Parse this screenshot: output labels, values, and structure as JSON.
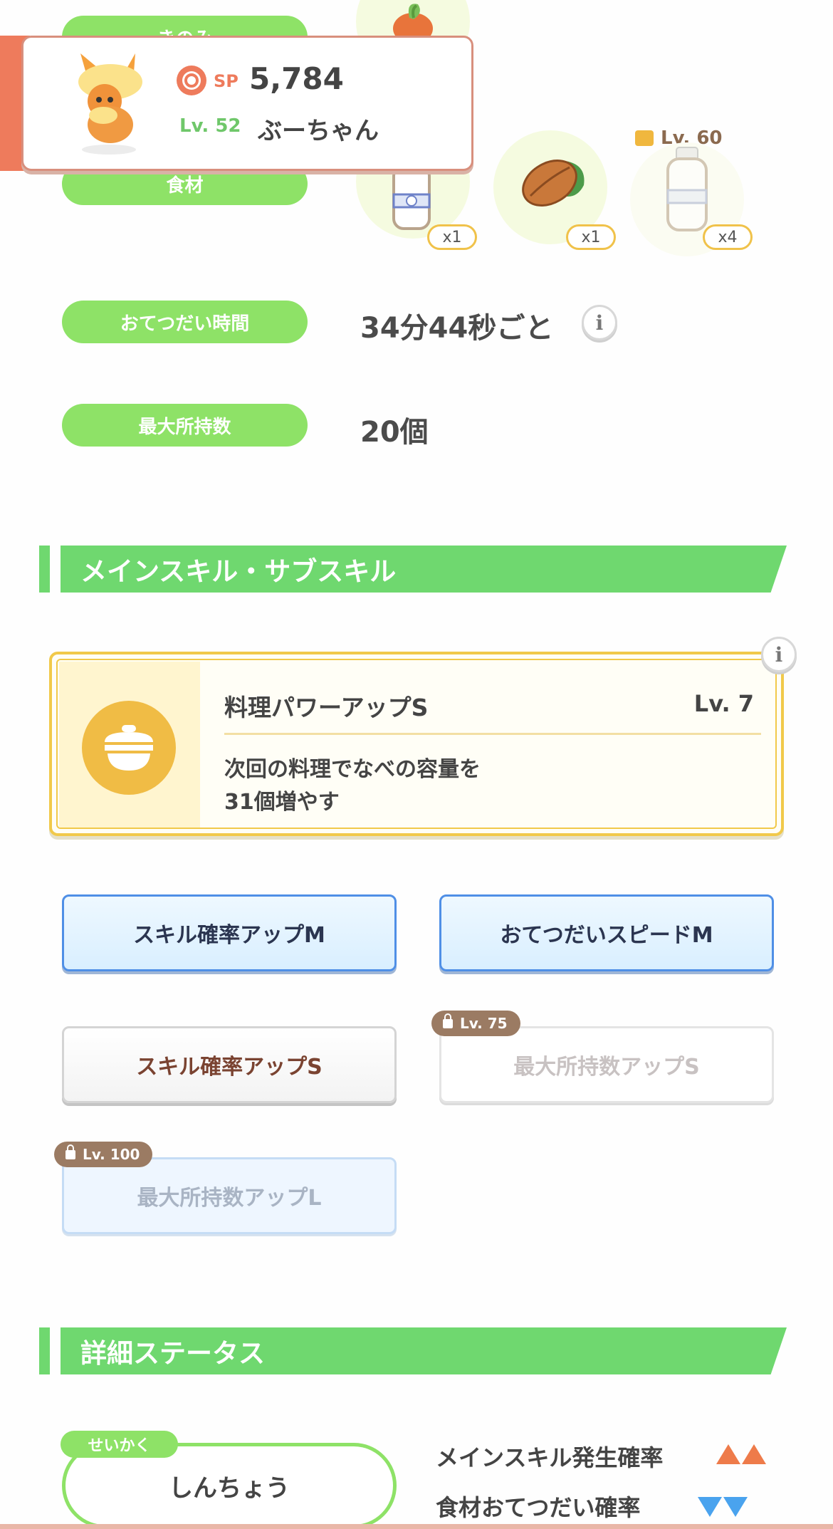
{
  "top": {
    "berry_label": "きのみ",
    "ingredients_label": "食材",
    "ingredients": [
      {
        "name": "milk",
        "qty": "x1",
        "locked": false
      },
      {
        "name": "cacao",
        "qty": "x1",
        "locked": false
      },
      {
        "name": "milk",
        "qty": "x4",
        "locked": true,
        "lock_level": "Lv. 60"
      }
    ]
  },
  "profile": {
    "sp_label": "SP",
    "sp_value": "5,784",
    "level": "Lv. 52",
    "nickname": "ぶーちゃん"
  },
  "help_time": {
    "label": "おてつだい時間",
    "value": "34分44秒ごと"
  },
  "max_carry": {
    "label": "最大所持数",
    "value": "20個"
  },
  "skills_section": {
    "title": "メインスキル・サブスキル"
  },
  "main_skill": {
    "name": "料理パワーアップS",
    "level": "Lv. 7",
    "desc_line1": "次回の料理でなべの容量を",
    "desc_line2": "31個増やす"
  },
  "sub_skills": [
    {
      "label": "スキル確率アップM",
      "style": "blue"
    },
    {
      "label": "おてつだいスピードM",
      "style": "blue"
    },
    {
      "label": "スキル確率アップS",
      "style": "white"
    },
    {
      "label": "最大所持数アップS",
      "style": "locked-white",
      "lock_level": "Lv. 75"
    },
    {
      "label": "最大所持数アップL",
      "style": "locked-blue",
      "lock_level": "Lv. 100"
    }
  ],
  "details_section": {
    "title": "詳細ステータス"
  },
  "nature": {
    "tag": "せいかく",
    "value": "しんちょう"
  },
  "stats": [
    {
      "label": "メインスキル発生確率",
      "direction": "up"
    },
    {
      "label": "食材おてつだい確率",
      "direction": "down"
    }
  ],
  "colors": {
    "accent_green": "#8ee267",
    "profile_accent": "#ee7b5c",
    "skill_gold": "#f1c94a",
    "up_color": "#ee7b4a",
    "down_color": "#4aa3ee"
  }
}
